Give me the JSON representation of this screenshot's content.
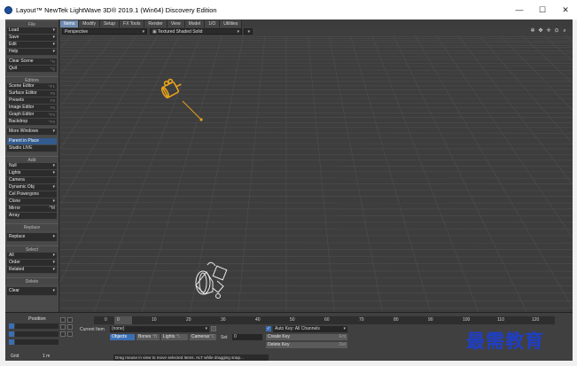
{
  "window": {
    "title": "Layout™ NewTek LightWave 3D® 2019.1 (Win64) Discovery Edition",
    "minimize": "—",
    "maximize": "☐",
    "close": "✕"
  },
  "tabs": [
    "Items",
    "Modify",
    "Setup",
    "FX Tools",
    "Render",
    "View",
    "Model",
    "1/O",
    "Utilities"
  ],
  "active_tab": "Items",
  "toolbar": {
    "view_mode": "Perspective",
    "shading_mode": "Textured Shaded Solid"
  },
  "sidebar": {
    "file_header": "File",
    "file_items": [
      {
        "label": "Load",
        "chev": "▾"
      },
      {
        "label": "Save",
        "chev": "▾"
      },
      {
        "label": "Edit",
        "chev": "▾"
      },
      {
        "label": "Help",
        "chev": "▾"
      }
    ],
    "clear_scene": {
      "label": "Clear Scene",
      "short": "^N"
    },
    "quit": {
      "label": "Quit",
      "short": "^Q"
    },
    "editors_header": "Editors",
    "editor_items": [
      {
        "label": "Scene Editor",
        "short": "^F1"
      },
      {
        "label": "Surface Editor",
        "short": "F5"
      },
      {
        "label": "Presets",
        "short": "F8"
      },
      {
        "label": "Image Editor",
        "short": "F6"
      },
      {
        "label": "Graph Editor",
        "short": "^F2"
      },
      {
        "label": "Backdrop",
        "short": "^F5"
      }
    ],
    "more_windows": {
      "label": "More Windows",
      "chev": "▾"
    },
    "parent_in_place": "Parent in Place",
    "studio_live": "Studio LIVE",
    "add_header": "Add",
    "add_items": [
      {
        "label": "Null",
        "chev": "▾"
      },
      {
        "label": "Lights",
        "chev": "▾"
      },
      {
        "label": "Camera",
        "chev": ""
      },
      {
        "label": "Dynamic Obj",
        "chev": "▾"
      },
      {
        "label": "Cel Powergons",
        "chev": ""
      },
      {
        "label": "Clone",
        "chev": "▾"
      },
      {
        "label": "Mirror",
        "chev": "^M"
      },
      {
        "label": "Array",
        "chev": ""
      }
    ],
    "replace_header": "Replace",
    "replace": {
      "label": "Replace",
      "chev": "▾"
    },
    "select_header": "Select",
    "select_items": [
      {
        "label": "All",
        "chev": "▾"
      },
      {
        "label": "Order",
        "chev": "▾"
      },
      {
        "label": "Related",
        "chev": "▾"
      }
    ],
    "delete_header": "Delete",
    "clear": {
      "label": "Clear",
      "chev": "▾"
    }
  },
  "bottom": {
    "position_label": "Position",
    "grid_label": "Grid",
    "grid_value": "1 m",
    "timeline_ticks": [
      "0",
      "0",
      "10",
      "20",
      "30",
      "40",
      "50",
      "60",
      "70",
      "80",
      "90",
      "100",
      "110",
      "120"
    ],
    "current_item_label": "Current Item",
    "current_item_value": "(none)",
    "objects_btn": "Objects",
    "bones_btn": "Bones",
    "bones_short": "^B",
    "lights_btn": "Lights",
    "lights_short": "^L",
    "cameras_btn": "Cameras",
    "cameras_short": "^C",
    "set_label": "Set",
    "set_value": "0",
    "auto_key_label": "Auto Key: All Channels",
    "create_key": "Create Key",
    "create_key_short": "Ent",
    "delete_key": "Delete Key",
    "delete_key_short": "Del",
    "status_text": "Drag mouse in view to move selected items. ALT while dragging snap..."
  },
  "watermark": "最需教育",
  "colors": {
    "accent": "#3b6fb4",
    "camera_selected": "#e8a21a",
    "grid_line": "#4c4c4c",
    "viewport_bg": "#3d3d3d"
  }
}
